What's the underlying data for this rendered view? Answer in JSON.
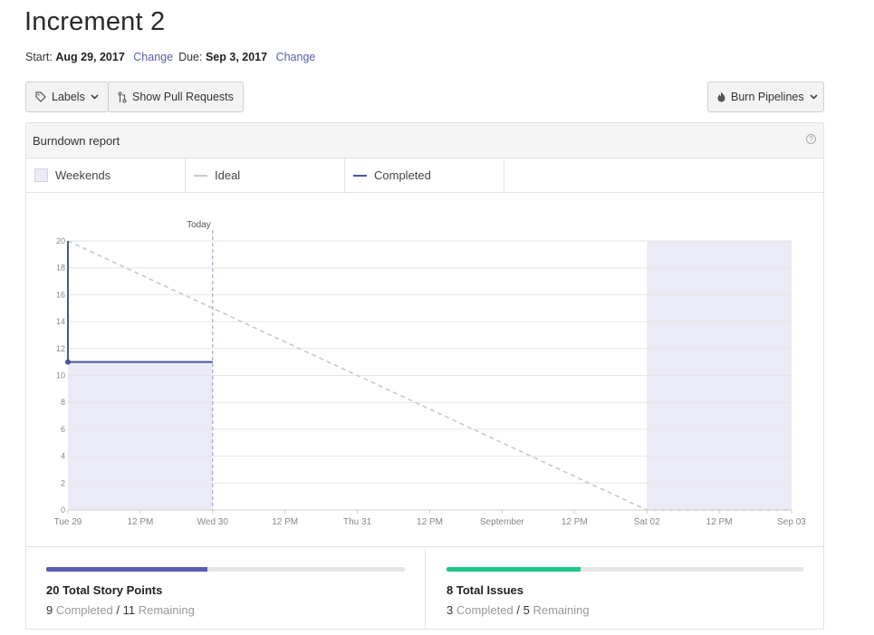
{
  "page": {
    "title": "Increment 2",
    "start_label": "Start:",
    "start_date": "Aug 29, 2017",
    "due_label": "Due:",
    "due_date": "Sep 3, 2017",
    "change_label": "Change"
  },
  "toolbar": {
    "labels_button": "Labels",
    "pull_requests_button": "Show Pull Requests",
    "pipelines_button": "Burn Pipelines"
  },
  "report": {
    "title": "Burndown report",
    "legend": {
      "weekends": "Weekends",
      "ideal": "Ideal",
      "completed": "Completed"
    },
    "today_label": "Today"
  },
  "colors": {
    "completed": "#4a5694",
    "ideal": "#c8c8c8",
    "weekend": "#ebebf7",
    "today_line": "#9b92d0",
    "points_bar": "#5c5cb4",
    "issues_bar": "#1dc68a",
    "link": "#5a5fb0"
  },
  "chart_data": {
    "type": "line",
    "title": "",
    "x_ticks": [
      "Tue 29",
      "12 PM",
      "Wed 30",
      "12 PM",
      "Thu 31",
      "12 PM",
      "September",
      "12 PM",
      "Sat 02",
      "12 PM",
      "Sep 03"
    ],
    "x_range": [
      "2017-08-29 00:00",
      "2017-09-03 00:00"
    ],
    "ylim": [
      0,
      20
    ],
    "y_ticks": [
      0,
      2,
      4,
      6,
      8,
      10,
      12,
      14,
      16,
      18,
      20
    ],
    "grid": true,
    "today": "2017-08-30 00:00",
    "weekend_shading": [
      {
        "start": "2017-08-29 00:00",
        "end": "2017-08-30 00:00",
        "to_value": 11
      },
      {
        "start": "2017-09-02 00:00",
        "end": "2017-09-03 00:00",
        "to_value": 20
      }
    ],
    "series": [
      {
        "name": "Ideal",
        "style": "dashed",
        "points": [
          {
            "x": "2017-08-29 00:00",
            "y": 20
          },
          {
            "x": "2017-09-02 00:00",
            "y": 0
          },
          {
            "x": "2017-09-03 00:00",
            "y": 0
          }
        ]
      },
      {
        "name": "Completed",
        "style": "solid",
        "points": [
          {
            "x": "2017-08-29 00:00",
            "y": 20
          },
          {
            "x": "2017-08-29 00:00",
            "y": 11
          },
          {
            "x": "2017-08-30 00:00",
            "y": 11
          }
        ]
      }
    ]
  },
  "stats": {
    "story_points": {
      "title": "20 Total Story Points",
      "completed": "9",
      "completed_label": "Completed",
      "separator": "/",
      "remaining": "11",
      "remaining_label": "Remaining",
      "progress": 0.45
    },
    "issues": {
      "title": "8 Total Issues",
      "completed": "3",
      "completed_label": "Completed",
      "separator": "/",
      "remaining": "5",
      "remaining_label": "Remaining",
      "progress": 0.375
    }
  }
}
